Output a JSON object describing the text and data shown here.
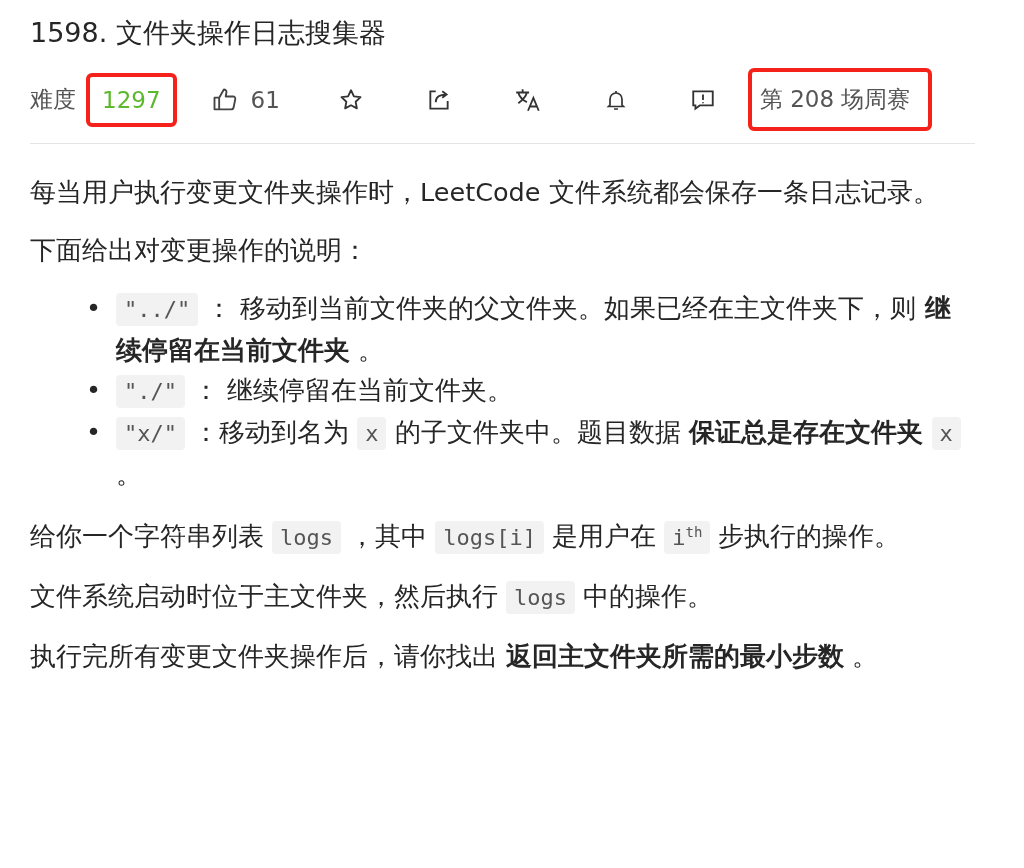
{
  "title": "1598. 文件夹操作日志搜集器",
  "toolbar": {
    "difficulty_label": "难度",
    "difficulty_value": "1297",
    "difficulty_highlighted": true,
    "likes": "61",
    "contest": "第 208 场周赛",
    "contest_highlighted": true,
    "icons": [
      {
        "kind": "star"
      },
      {
        "kind": "share"
      },
      {
        "kind": "translate"
      },
      {
        "kind": "bell"
      },
      {
        "kind": "feedback"
      }
    ]
  },
  "blocks": [
    {
      "kind": "para",
      "segments": [
        {
          "kind": "text",
          "text": "每当用户执行变更文件夹操作时，LeetCode 文件系统都会保存一条日志记录。"
        }
      ]
    },
    {
      "kind": "para",
      "segments": [
        {
          "kind": "text",
          "text": "下面给出对变更操作的说明："
        }
      ]
    },
    {
      "kind": "list",
      "marker": "•",
      "items": [
        [
          {
            "kind": "code",
            "text": "\"../\""
          },
          {
            "kind": "text",
            "text": " ： 移动到当前文件夹的父文件夹。如果已经在主文件夹下，则 "
          },
          {
            "kind": "bold",
            "text": "继续停留在当前文件夹"
          },
          {
            "kind": "text",
            "text": " 。"
          }
        ],
        [
          {
            "kind": "code",
            "text": "\"./\""
          },
          {
            "kind": "text",
            "text": " ： 继续停留在当前文件夹。"
          }
        ],
        [
          {
            "kind": "code",
            "text": "\"x/\""
          },
          {
            "kind": "text",
            "text": " ：移动到名为 "
          },
          {
            "kind": "code",
            "text": "x"
          },
          {
            "kind": "text",
            "text": " 的子文件夹中。题目数据 "
          },
          {
            "kind": "bold",
            "text": "保证总是存在文件夹 "
          },
          {
            "kind": "code",
            "text": "x"
          },
          {
            "kind": "text",
            "text": " 。"
          }
        ]
      ]
    },
    {
      "kind": "para",
      "segments": [
        {
          "kind": "text",
          "text": "给你一个字符串列表 "
        },
        {
          "kind": "code",
          "text": "logs"
        },
        {
          "kind": "text",
          "text": " ，其中 "
        },
        {
          "kind": "code",
          "text": "logs[i]"
        },
        {
          "kind": "text",
          "text": " 是用户在 "
        },
        {
          "kind": "code",
          "text": "i$^{th}$"
        },
        {
          "kind": "text",
          "text": " 步执行的操作。"
        }
      ]
    },
    {
      "kind": "para",
      "segments": [
        {
          "kind": "text",
          "text": "文件系统启动时位于主文件夹，然后执行 "
        },
        {
          "kind": "code",
          "text": "logs"
        },
        {
          "kind": "text",
          "text": " 中的操作。"
        }
      ]
    },
    {
      "kind": "para",
      "segments": [
        {
          "kind": "text",
          "text": "执行完所有变更文件夹操作后，请你找出 "
        },
        {
          "kind": "bold",
          "text": "返回主文件夹所需的最小步数"
        },
        {
          "kind": "text",
          "text": " 。"
        }
      ]
    }
  ]
}
